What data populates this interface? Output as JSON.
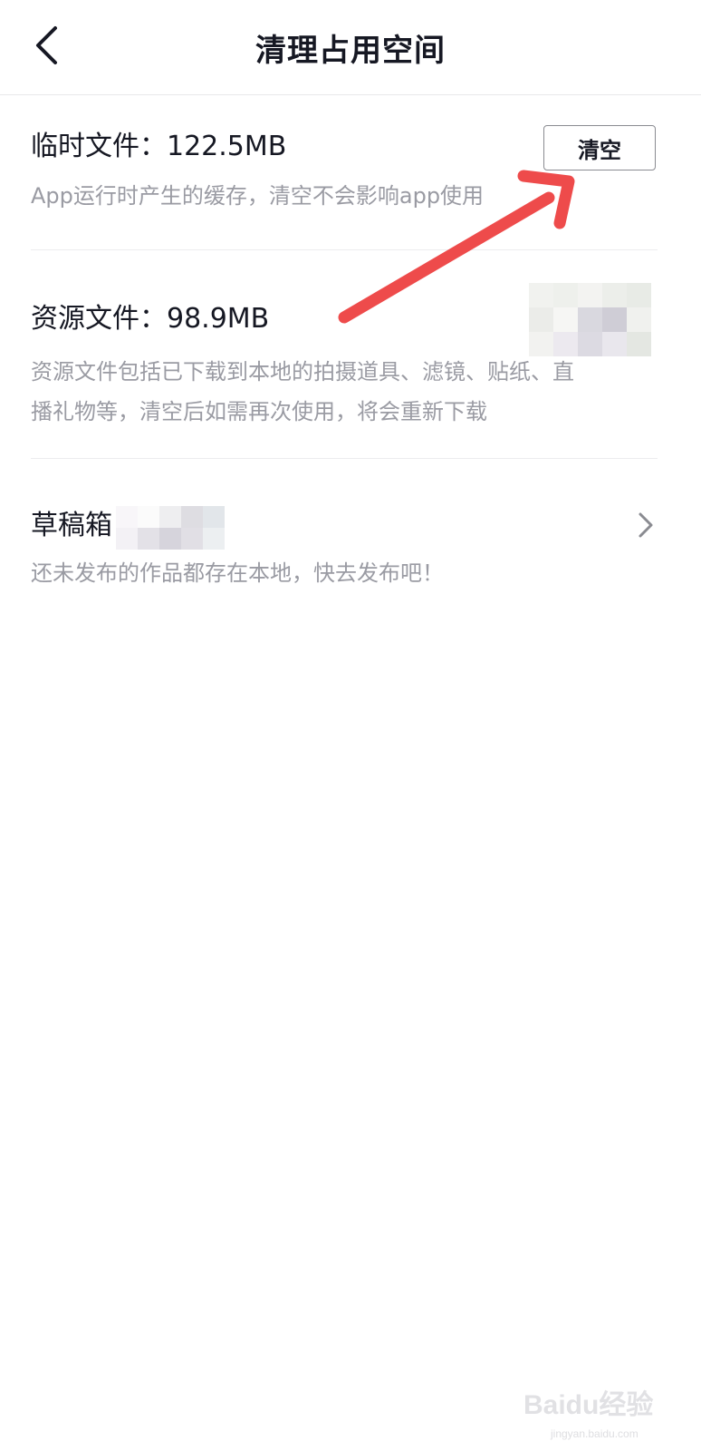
{
  "header": {
    "title": "清理占用空间"
  },
  "temp_files": {
    "title": "临时文件：122.5MB",
    "description": "App运行时产生的缓存，清空不会影响app使用",
    "clear_label": "清空"
  },
  "resource_files": {
    "title": "资源文件：98.9MB",
    "description_line1": "资源文件包括已下载到本地的拍摄道具、滤镜、贴纸、直",
    "description_line2": "播礼物等，清空后如需再次使用，将会重新下载"
  },
  "drafts": {
    "title": "草稿箱",
    "description": "还未发布的作品都存在本地，快去发布吧！"
  },
  "watermark": {
    "brand": "Baidu经验",
    "url": "jingyan.baidu.com"
  },
  "colors": {
    "primary_text": "#161823",
    "secondary_text": "#9a9ba3",
    "divider": "#ececee",
    "annotation_arrow": "#ee4b4b"
  }
}
